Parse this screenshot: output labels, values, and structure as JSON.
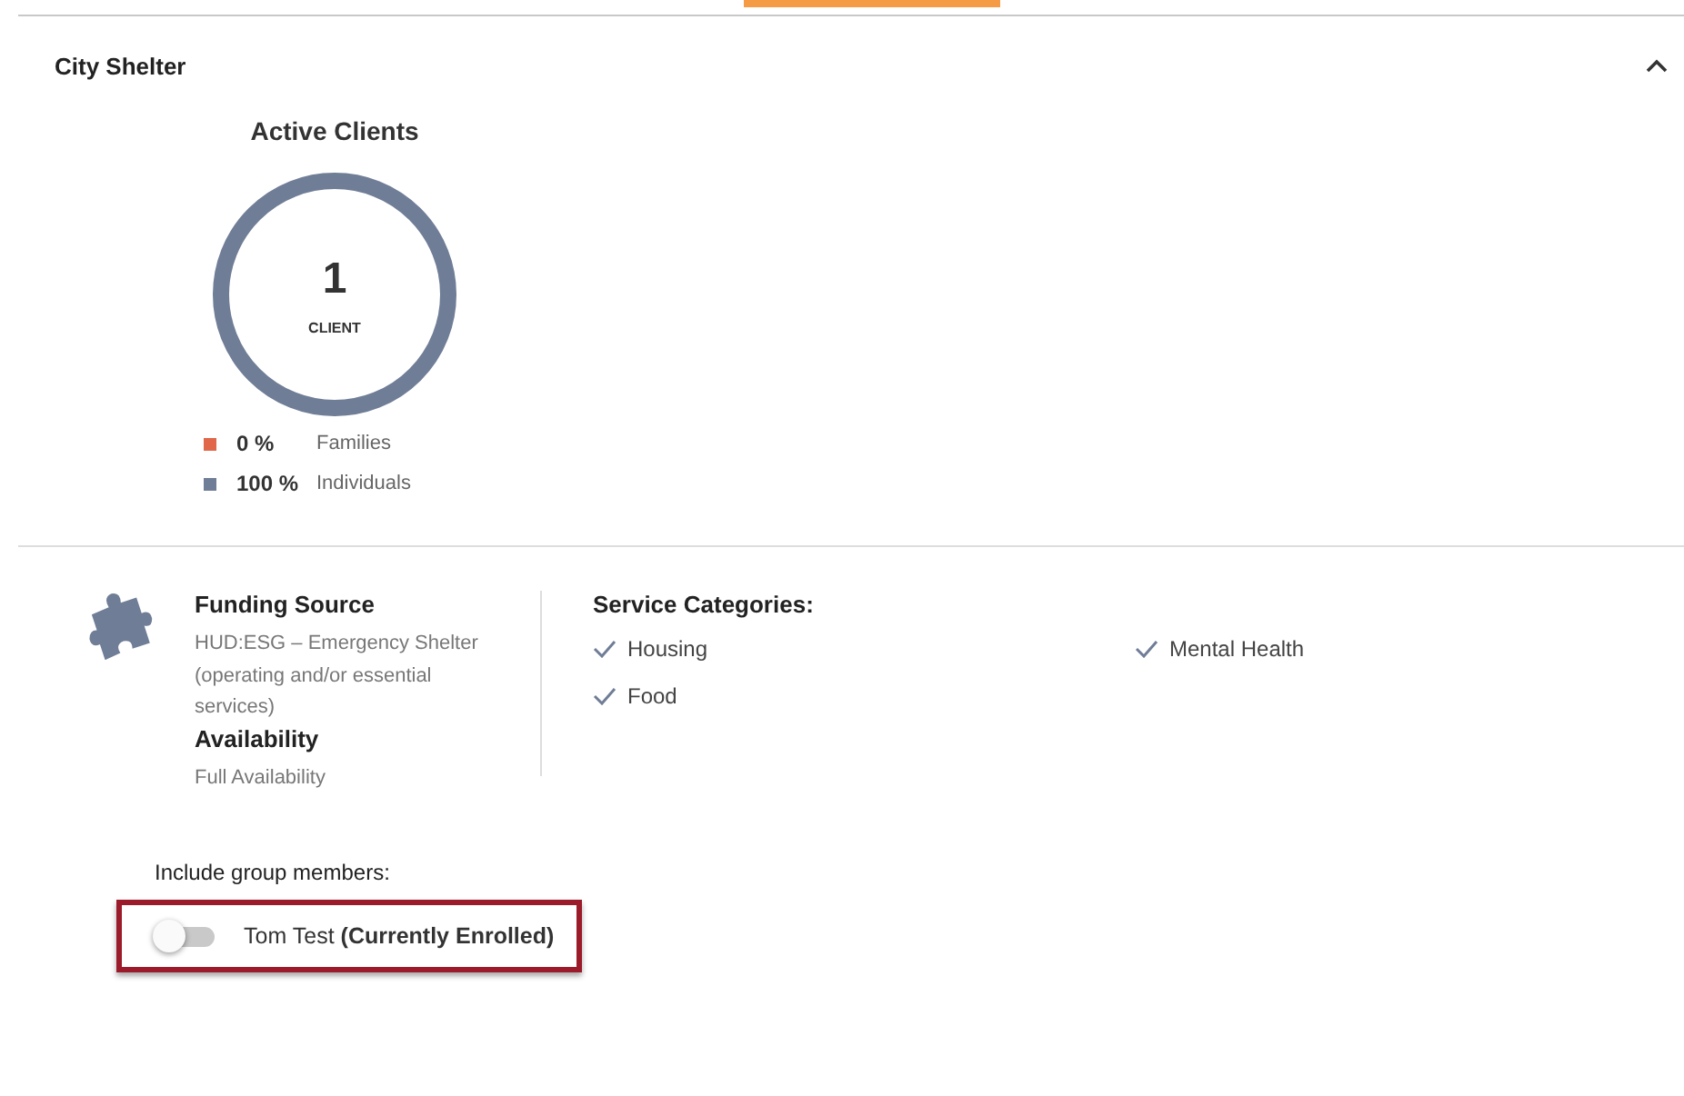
{
  "section": {
    "title": "City Shelter",
    "expanded": true
  },
  "active_clients": {
    "title": "Active Clients",
    "count": "1",
    "unit": "CLIENT",
    "legend": [
      {
        "percent": "0 %",
        "label": "Families",
        "color": "#e0674a"
      },
      {
        "percent": "100 %",
        "label": "Individuals",
        "color": "#6f7d96"
      }
    ]
  },
  "funding": {
    "title": "Funding Source",
    "value": "HUD:ESG – Emergency Shelter (operating and/or essential services)",
    "availability_title": "Availability",
    "availability": "Full Availability"
  },
  "service_categories": {
    "title": "Service Categories:",
    "items": [
      {
        "label": "Housing",
        "checked": true
      },
      {
        "label": "Mental Health",
        "checked": true
      },
      {
        "label": "Food",
        "checked": true
      }
    ]
  },
  "group_members": {
    "title": "Include group members:",
    "members": [
      {
        "name": "Tom Test",
        "status": "(Currently Enrolled)",
        "on": false
      }
    ]
  }
}
